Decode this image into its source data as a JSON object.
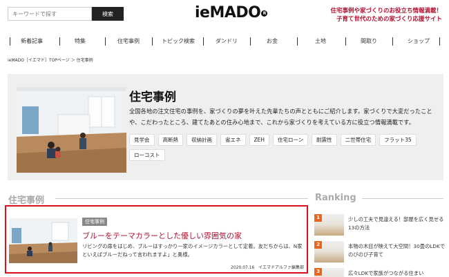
{
  "header": {
    "search_placeholder": "キーワードで探す",
    "search_button": "検索",
    "logo_text": "ieMADO",
    "logo_mark": "R",
    "tagline_1": "住宅事例や家づくりのお役立ち情報満載！",
    "tagline_2": "子育て世代のための家づくり応援サイト"
  },
  "nav": {
    "items": [
      "新着記事",
      "特集",
      "住宅事例",
      "トピック検索",
      "ダンドリ",
      "お金",
      "土地",
      "間取り",
      "ショップ"
    ]
  },
  "breadcrumb": "ieMADO［イエマド］TOPページ ＞ 住宅事例",
  "hero": {
    "title": "住宅事例",
    "description": "全国各地の注文住宅の事例を、家づくりの夢を叶えた先輩たちの声とともにご紹介します。家づくりで大変だったことや、こだわったところ、建てたあとの住み心地まで、これから家づくりを考えている方に役立つ情報満載です。",
    "tags": [
      "見学会",
      "高断熱",
      "収納計画",
      "省エネ",
      "ZEH",
      "住宅ローン",
      "耐震性",
      "二世帯住宅",
      "フラット35",
      "ローコスト"
    ]
  },
  "sections": {
    "left_heading": "住宅事例",
    "right_heading": "Ranking"
  },
  "article": {
    "badge": "住宅事例",
    "title": "ブルーをテーマカラーとした優しい雰囲気の家",
    "excerpt": "リビングの扉をはじめ、ブルーはすっかり一家のイメージカラーとして定着。友だちからは、N家といえばブルーだねって言われますよ」と奥様。",
    "date": "2020.07.16",
    "author": "イエマドアルファ編集部"
  },
  "ranking": [
    {
      "num": "1",
      "text": "少しの工夫で見違える！部屋を広く見せる13の方法"
    },
    {
      "num": "2",
      "text": "本物の木目が映えて大空間！30畳のLDKでのびのび子育て"
    },
    {
      "num": "3",
      "text": "広々LDKで家族がつながる住まい"
    }
  ],
  "colors": {
    "accent": "#b01030",
    "highlight_border": "#d9101b",
    "rank_badge": "#e8671c"
  }
}
